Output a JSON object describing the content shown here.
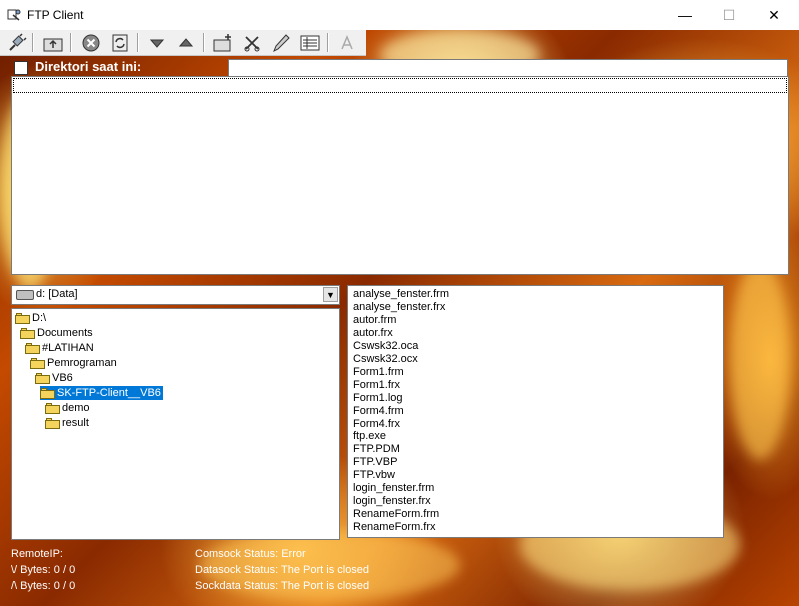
{
  "window": {
    "title": "FTP Client",
    "minimize": "—",
    "maximize": "☐",
    "close": "✕"
  },
  "toolbar": {
    "buttons": [
      {
        "name": "connect-icon"
      },
      {
        "name": "parent-folder-icon"
      },
      {
        "name": "stop-icon"
      },
      {
        "name": "refresh-icon"
      },
      {
        "name": "download-icon"
      },
      {
        "name": "upload-icon"
      },
      {
        "name": "new-folder-icon"
      },
      {
        "name": "delete-icon"
      },
      {
        "name": "rename-icon"
      },
      {
        "name": "view-list-icon"
      },
      {
        "name": "font-icon"
      }
    ]
  },
  "directory": {
    "label": "Direktori saat ini:",
    "value": ""
  },
  "drive": {
    "value": "d: [Data]"
  },
  "tree": [
    {
      "label": "D:\\",
      "indent": 0
    },
    {
      "label": "Documents",
      "indent": 1
    },
    {
      "label": "#LATIHAN",
      "indent": 2
    },
    {
      "label": "Pemrograman",
      "indent": 3
    },
    {
      "label": "VB6",
      "indent": 4
    },
    {
      "label": "SK-FTP-Client__VB6",
      "indent": 5,
      "selected": true
    },
    {
      "label": "demo",
      "indent": 6
    },
    {
      "label": "result",
      "indent": 6
    }
  ],
  "files": [
    "analyse_fenster.frm",
    "analyse_fenster.frx",
    "autor.frm",
    "autor.frx",
    "Cswsk32.oca",
    "Cswsk32.ocx",
    "Form1.frm",
    "Form1.frx",
    "Form1.log",
    "Form4.frm",
    "Form4.frx",
    "ftp.exe",
    "FTP.PDM",
    "FTP.VBP",
    "FTP.vbw",
    "login_fenster.frm",
    "login_fenster.frx",
    "RenameForm.frm",
    "RenameForm.frx"
  ],
  "status": {
    "remote_ip": "RemoteIP:",
    "bytes_down": "\\/ Bytes: 0 / 0",
    "bytes_up": "/\\ Bytes: 0 / 0",
    "comsock": "Comsock Status: Error",
    "datasock": "Datasock Status: The Port is closed",
    "sockdata": "Sockdata Status: The Port is closed"
  }
}
